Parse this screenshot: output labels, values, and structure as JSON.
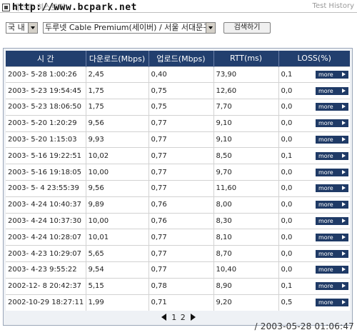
{
  "header": {
    "title": "테스트 히스토리",
    "watermark": "http://www.bcpark.net",
    "right_title": "Test History"
  },
  "controls": {
    "region_value": "국 내",
    "server_value": "두루넷 Cable Premium(세이버) / 서울 서대문구",
    "search_label": "검색하기"
  },
  "table": {
    "columns": [
      "시 간",
      "다운로드(Mbps)",
      "업로드(Mbps)",
      "RTT(ms)",
      "LOSS(%)"
    ],
    "more_label": "more",
    "rows": [
      [
        "2003- 5-28  1:00:26",
        "2,45",
        "0,40",
        "73,90",
        "0,1"
      ],
      [
        "2003- 5-23 19:54:45",
        "1,75",
        "0,75",
        "12,60",
        "0,0"
      ],
      [
        "2003- 5-23 18:06:50",
        "1,75",
        "0,75",
        "7,70",
        "0,0"
      ],
      [
        "2003- 5-20  1:20:29",
        "9,56",
        "0,77",
        "9,10",
        "0,0"
      ],
      [
        "2003- 5-20  1:15:03",
        "9,93",
        "0,77",
        "9,10",
        "0,0"
      ],
      [
        "2003- 5-16 19:22:51",
        "10,02",
        "0,77",
        "8,50",
        "0,1"
      ],
      [
        "2003- 5-16 19:18:05",
        "10,00",
        "0,77",
        "9,70",
        "0,0"
      ],
      [
        "2003- 5- 4 23:55:39",
        "9,56",
        "0,77",
        "11,60",
        "0,0"
      ],
      [
        "2003- 4-24 10:40:37",
        "9,89",
        "0,76",
        "8,00",
        "0,0"
      ],
      [
        "2003- 4-24 10:37:30",
        "10,00",
        "0,76",
        "8,30",
        "0,0"
      ],
      [
        "2003- 4-24 10:28:07",
        "10,01",
        "0,77",
        "8,10",
        "0,0"
      ],
      [
        "2003- 4-23 10:29:07",
        "5,65",
        "0,77",
        "8,70",
        "0,0"
      ],
      [
        "2003- 4-23  9:55:22",
        "9,54",
        "0,77",
        "10,40",
        "0,0"
      ],
      [
        "2002-12- 8 20:42:37",
        "5,15",
        "0,78",
        "8,90",
        "0,1"
      ],
      [
        "2002-10-29 18:27:11",
        "1,99",
        "0,71",
        "9,20",
        "0,5"
      ]
    ]
  },
  "pager": {
    "pages": [
      "1",
      "2"
    ]
  },
  "stamp": "/ 2003-05-28 01:06:47",
  "colors": {
    "header_bg": "#223f6e",
    "more_bg": "#1f3a66"
  },
  "icons": {
    "prev": "triangle-left-icon",
    "next": "triangle-right-icon",
    "logo": "square-logo-icon"
  }
}
